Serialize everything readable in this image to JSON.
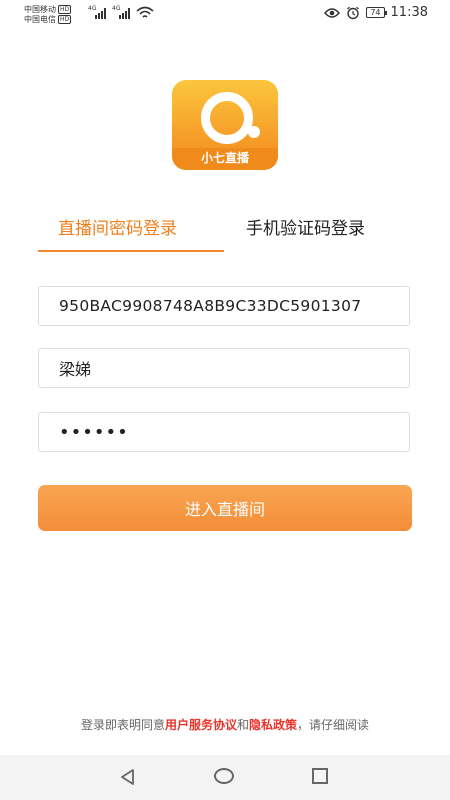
{
  "status_bar": {
    "carrier1": "中国移动",
    "carrier2": "中国电信",
    "hd_badge": "HD",
    "network": "4G",
    "battery": "74",
    "time": "11:38",
    "icons": [
      "eye-icon",
      "alarm-icon",
      "battery-icon",
      "wifi-icon",
      "signal-icon"
    ]
  },
  "logo": {
    "name": "小七直播",
    "colors": {
      "top": "#fbc63d",
      "bottom": "#f28a1f"
    }
  },
  "tabs": [
    {
      "label": "直播间密码登录",
      "active": true
    },
    {
      "label": "手机验证码登录",
      "active": false
    }
  ],
  "form": {
    "room_id_value": "950BAC9908748A8B9C33DC5901307",
    "username_value": "梁娣",
    "password_value": "••••••"
  },
  "enter_button": {
    "label": "进入直播间"
  },
  "agreement": {
    "prefix": "登录即表明同意",
    "link1": "用户服务协议",
    "middle": "和",
    "link2": "隐私政策",
    "suffix": "，请仔细阅读"
  },
  "colors": {
    "accent": "#f07f1e",
    "button": "#f39543",
    "link": "#e8352c"
  }
}
